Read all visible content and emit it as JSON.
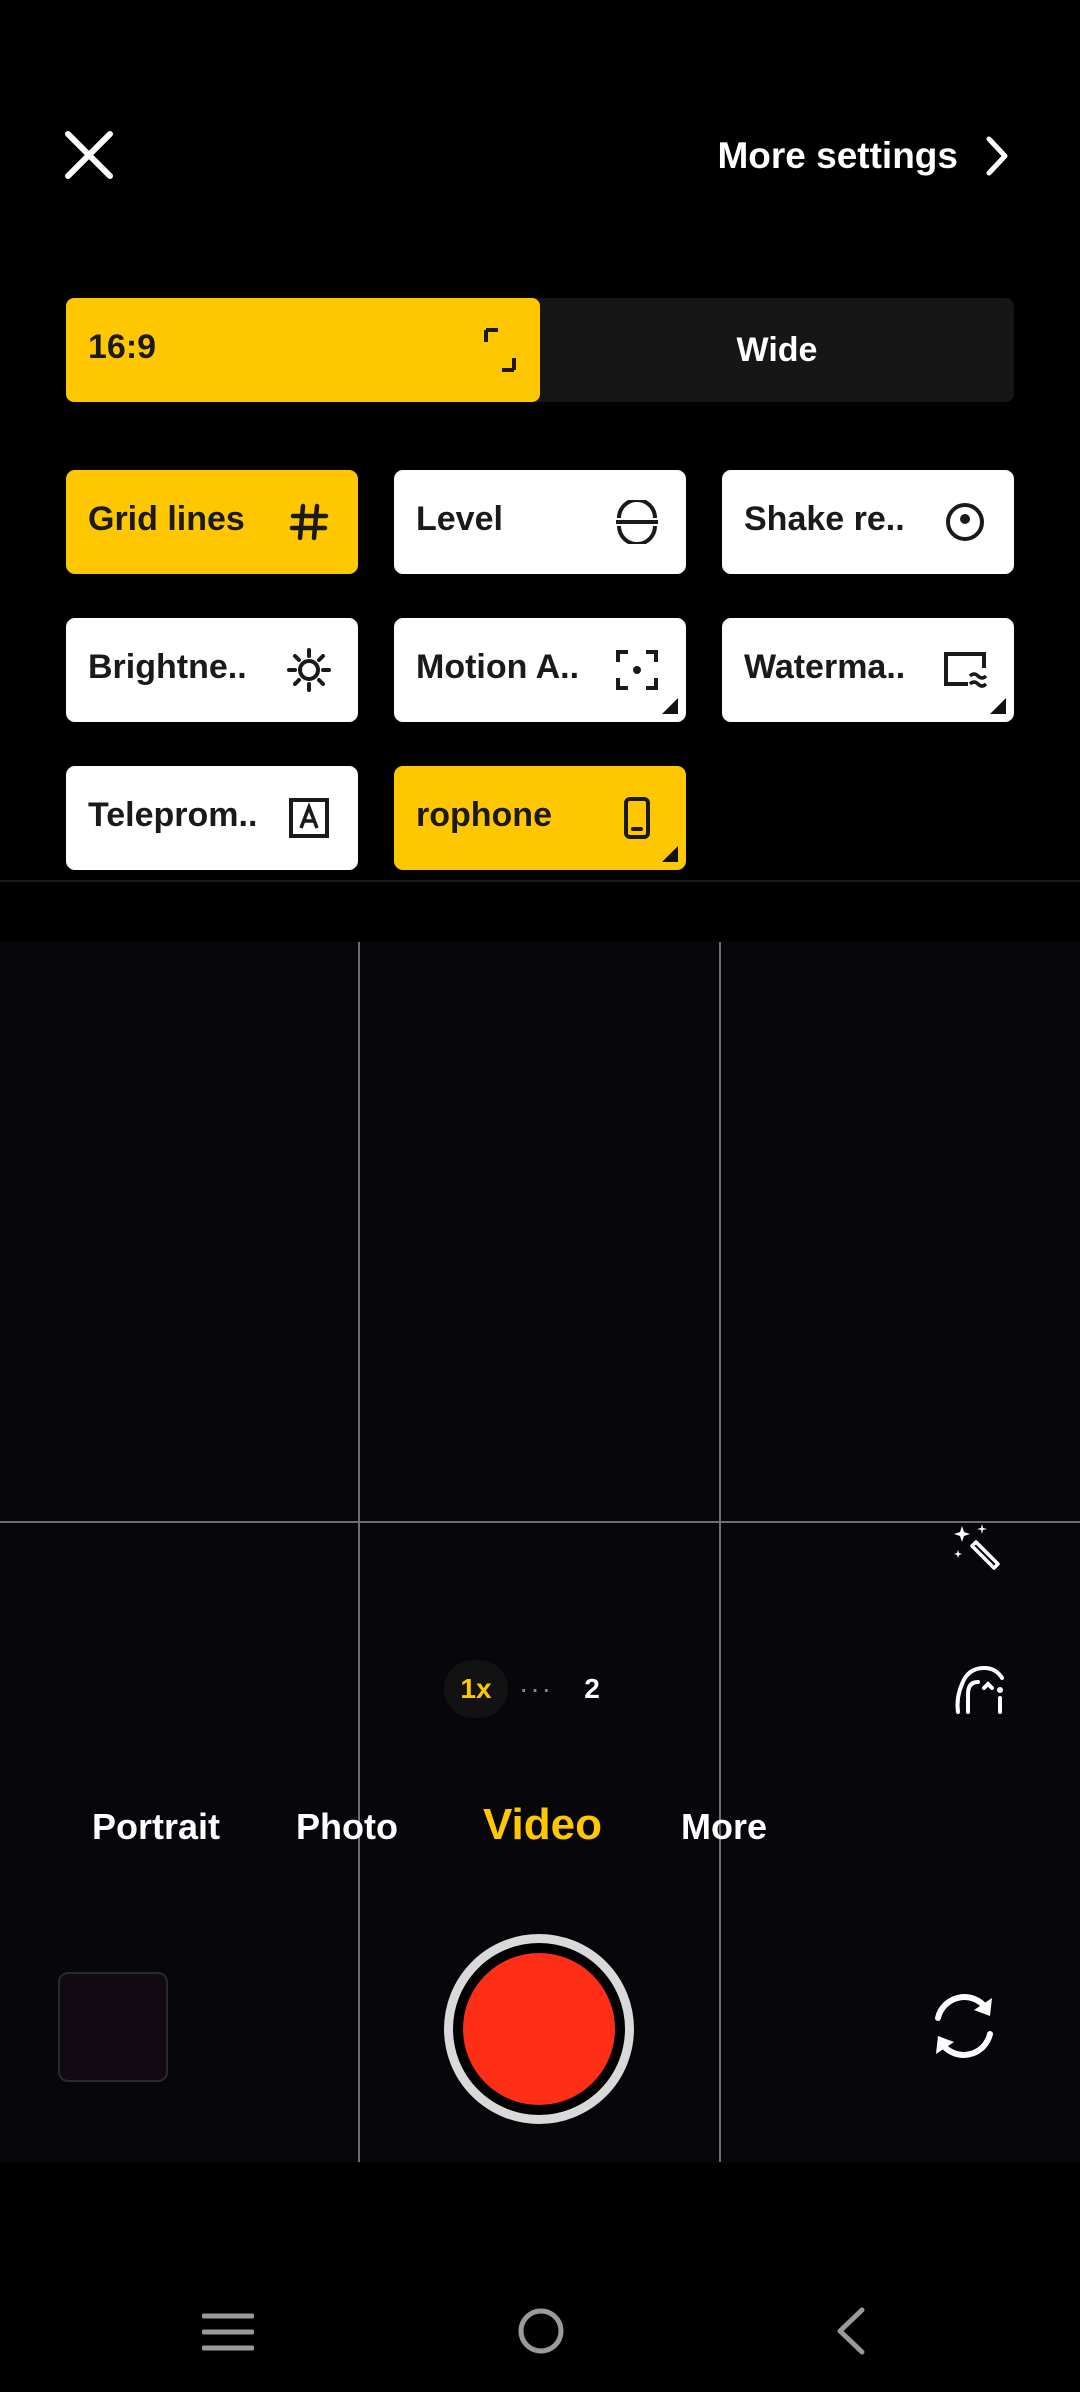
{
  "top_bar": {
    "close_icon": "close-icon",
    "more_settings_label": "More settings",
    "chevron_icon": "chevron-right-icon"
  },
  "aspect_ratio": {
    "options": [
      "16:9",
      "Wide"
    ],
    "selected": "16:9"
  },
  "tiles": [
    {
      "label": "Grid lines",
      "icon": "grid-icon",
      "active": true
    },
    {
      "label": "Level",
      "icon": "level-icon",
      "active": false
    },
    {
      "label": "Shake re..",
      "icon": "shake-reduction-icon",
      "active": false
    },
    {
      "label": "Brightne..",
      "icon": "brightness-icon",
      "active": false
    },
    {
      "label": "Motion A..",
      "icon": "motion-focus-icon",
      "active": false
    },
    {
      "label": "Waterma..",
      "icon": "watermark-icon",
      "active": false
    },
    {
      "label": "Teleprom..",
      "icon": "teleprompter-icon",
      "active": false
    },
    {
      "label": "rophone",
      "icon": "phone-icon",
      "active": true
    }
  ],
  "zoom": {
    "current": "1x",
    "dots": "···",
    "next": "2"
  },
  "modes": [
    "Portrait",
    "Photo",
    "Video",
    "More"
  ],
  "active_mode": "Video",
  "colors": {
    "accent": "#ffc700",
    "shutter": "#ff2e17",
    "background": "#000000"
  }
}
